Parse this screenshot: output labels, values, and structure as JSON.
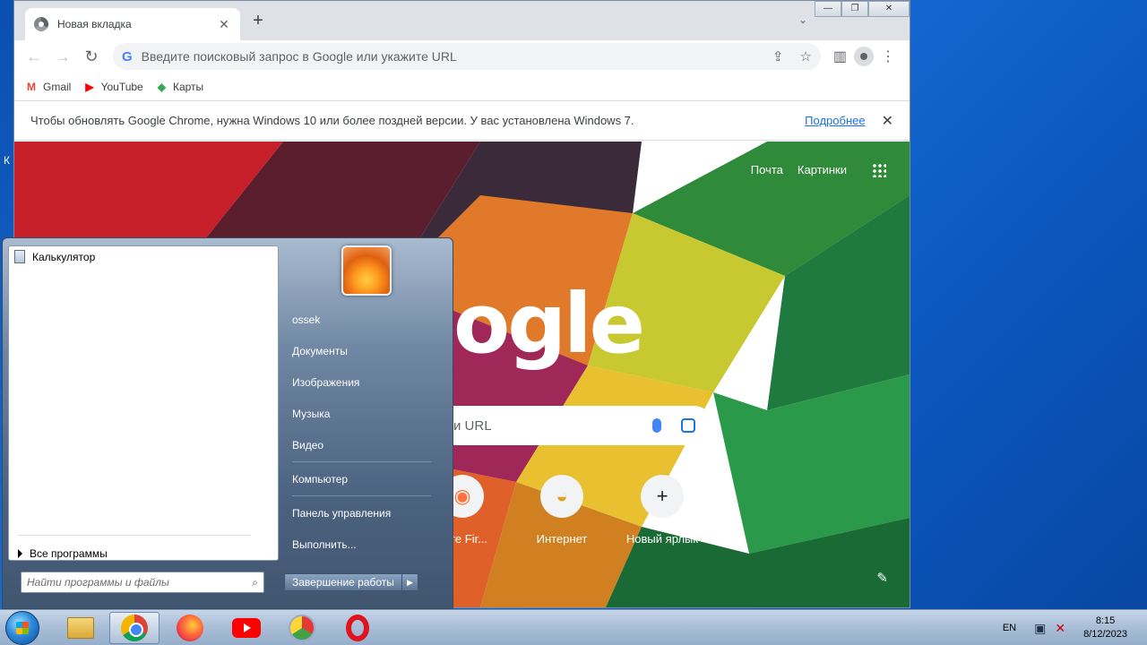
{
  "desktop": {
    "label": "К"
  },
  "window": {
    "minimize": "—",
    "restore": "❐",
    "close": "✕"
  },
  "tab": {
    "title": "Новая вкладка",
    "close": "✕",
    "new": "+",
    "menu": "⌄"
  },
  "toolbar": {
    "back": "←",
    "forward": "→",
    "reload": "↻",
    "omnibox_placeholder": "Введите поисковый запрос в Google или укажите URL",
    "omnibox_logo": "G",
    "share": "⇪",
    "star": "☆",
    "sidepanel": "▥",
    "menu": "⋮"
  },
  "bookmarks": [
    {
      "label": "Gmail",
      "icon": "M",
      "color": "#ea4335"
    },
    {
      "label": "YouTube",
      "icon": "▶",
      "color": "#ff0000"
    },
    {
      "label": "Карты",
      "icon": "◆",
      "color": "#34a853"
    }
  ],
  "infobar": {
    "message": "Чтобы обновлять Google Chrome, нужна Windows 10 или более поздней версии. У вас установлена Windows 7.",
    "link": "Подробнее",
    "close": "✕"
  },
  "ntp": {
    "links": [
      "Почта",
      "Картинки"
    ],
    "logo": "ogle",
    "search_placeholder": "и URL",
    "shortcuts": [
      {
        "label": "вите Fir...",
        "icon": "◉"
      },
      {
        "label": "Интернет",
        "icon": "◒"
      },
      {
        "label": "Новый ярлык",
        "icon": "+"
      }
    ],
    "edit": "✎"
  },
  "startmenu": {
    "pinned": [
      "Калькулятор"
    ],
    "all_programs": "Все программы",
    "search_placeholder": "Найти программы и файлы",
    "search_icon": "⌕",
    "right_items": [
      "ossek",
      "Документы",
      "Изображения",
      "Музыка",
      "Видео",
      "Компьютер",
      "Панель управления",
      "Выполнить..."
    ],
    "shutdown": "Завершение работы",
    "shutdown_arrow": "▶"
  },
  "taskbar": {
    "lang": "EN",
    "time": "8:15",
    "date": "8/12/2023"
  }
}
